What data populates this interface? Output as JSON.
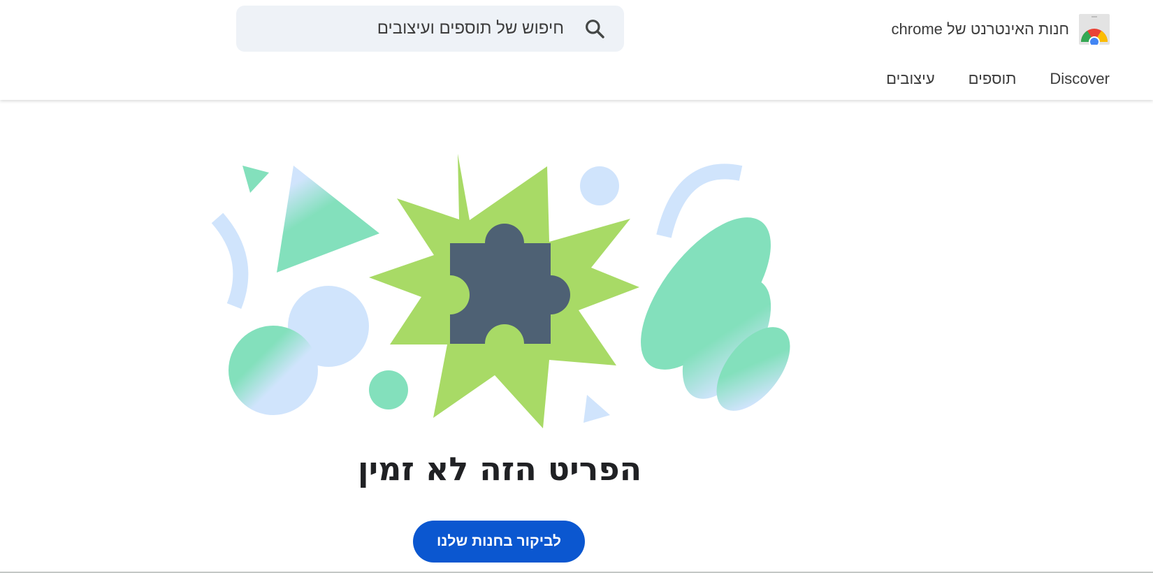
{
  "header": {
    "store_title": "חנות האינטרנט של chrome",
    "search": {
      "placeholder": "חיפוש של תוספים ועיצובים"
    },
    "nav": [
      {
        "label": "Discover"
      },
      {
        "label": "תוספים"
      },
      {
        "label": "עיצובים"
      }
    ]
  },
  "main": {
    "title": "הפריט הזה לא זמין",
    "cta_label": "לביקור בחנות שלנו"
  },
  "colors": {
    "cta": "#0b57d0",
    "puzzle": "#4e6174",
    "star": "#a8da66",
    "mint": "#83e0bc",
    "light_blue": "#d0e4fc"
  },
  "icons": [
    "chrome-store-logo-icon",
    "search-icon",
    "puzzle-piece-icon"
  ]
}
